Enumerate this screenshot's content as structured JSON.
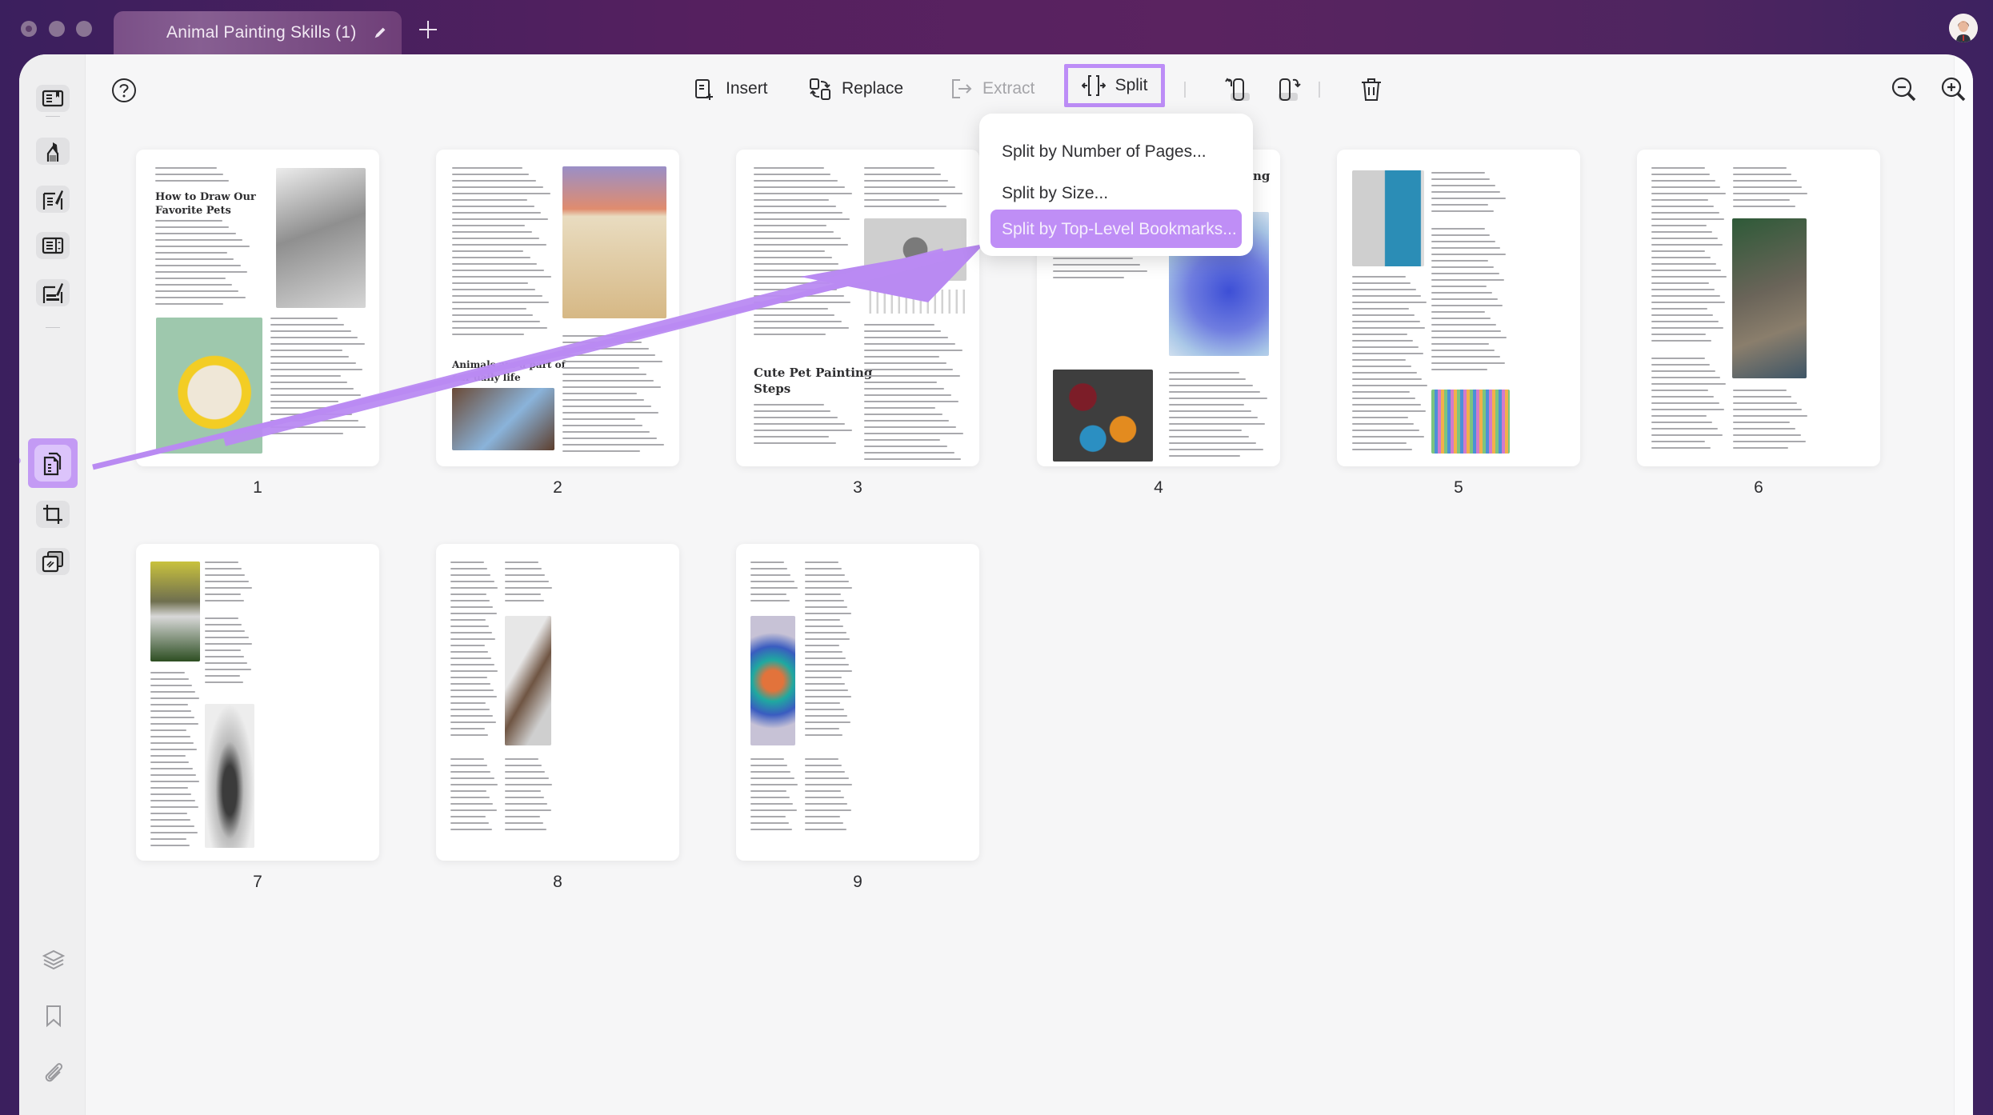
{
  "window": {
    "tab_title": "Animal Painting Skills (1)"
  },
  "toolbar": {
    "insert_label": "Insert",
    "replace_label": "Replace",
    "extract_label": "Extract",
    "split_label": "Split"
  },
  "split_menu": {
    "items": [
      {
        "label": "Split by Number of Pages..."
      },
      {
        "label": "Split by Size..."
      },
      {
        "label": "Split by Top-Level Bookmarks...",
        "selected": true
      }
    ]
  },
  "colors": {
    "accent": "#bd8df7",
    "accent_light": "#dcc4fb",
    "titlebar": "#55205f"
  },
  "pages": [
    {
      "number": "1",
      "heading": "How to Draw Our Favorite Pets"
    },
    {
      "number": "2",
      "heading": "Animals are a part of our daily life"
    },
    {
      "number": "3",
      "heading": "Cute Pet Painting Steps"
    },
    {
      "number": "4",
      "heading": "ng"
    },
    {
      "number": "5",
      "heading": ""
    },
    {
      "number": "6",
      "heading": ""
    },
    {
      "number": "7",
      "heading": ""
    },
    {
      "number": "8",
      "heading": ""
    },
    {
      "number": "9",
      "heading": ""
    }
  ]
}
